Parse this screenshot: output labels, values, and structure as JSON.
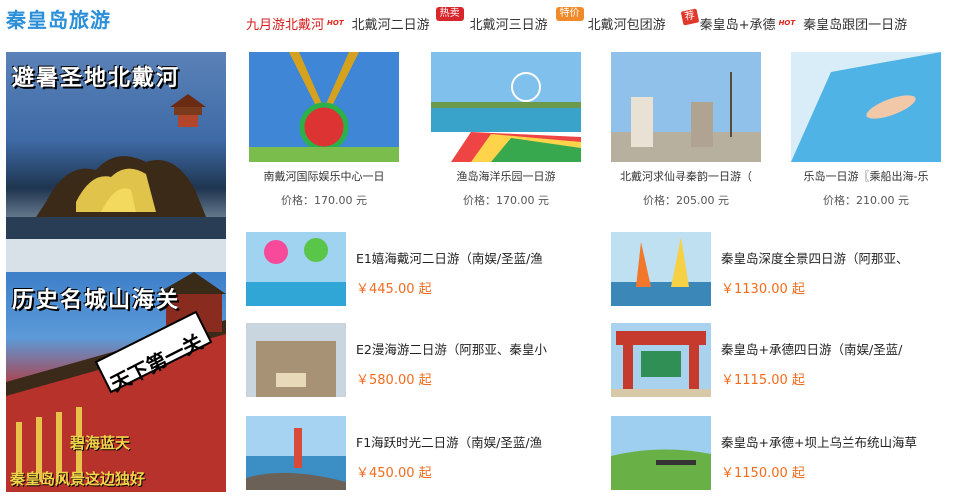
{
  "site": {
    "title": "秦皇岛旅游"
  },
  "nav": {
    "items": [
      {
        "label": "九月游北戴河",
        "active": true,
        "badge": "hot"
      },
      {
        "label": "北戴河二日游",
        "tag": "热卖"
      },
      {
        "label": "北戴河三日游",
        "tag": "特价"
      },
      {
        "label": "北戴河包团游",
        "tag": "荐"
      },
      {
        "label": "秦皇岛+承德",
        "badge": "hot"
      },
      {
        "label": "秦皇岛跟团一日游"
      }
    ],
    "hot_text": "HOT"
  },
  "banners": [
    {
      "caption": "避暑圣地北戴河"
    },
    {
      "caption": "历史名城山海关",
      "sign": "天下第一关",
      "sub1": "碧海蓝天",
      "sub2": "秦皇岛风景这边独好"
    }
  ],
  "top_products": [
    {
      "name": "南戴河国际娱乐中心一日",
      "price": "价格：170.00 元"
    },
    {
      "name": "渔岛海洋乐园一日游",
      "price": "价格：170.00 元"
    },
    {
      "name": "北戴河求仙寻秦韵一日游（",
      "price": "价格：205.00 元"
    },
    {
      "name": "乐岛一日游〖乘船出海-乐",
      "price": "价格：210.00 元"
    }
  ],
  "list_products": [
    {
      "title": "E1嬉海戴河二日游（南娱/圣蓝/渔",
      "price": "￥445.00 起"
    },
    {
      "title": "秦皇岛深度全景四日游（阿那亚、",
      "price": "￥1130.00 起"
    },
    {
      "title": "E2漫海游二日游（阿那亚、秦皇小",
      "price": "￥580.00 起"
    },
    {
      "title": "秦皇岛+承德四日游（南娱/圣蓝/",
      "price": "￥1115.00 起"
    },
    {
      "title": "F1海跃时光二日游（南娱/圣蓝/渔",
      "price": "￥450.00 起"
    },
    {
      "title": "秦皇岛+承德+坝上乌兰布统山海草",
      "price": "￥1150.00 起"
    }
  ],
  "colors": {
    "title": "#2a8fd8",
    "price": "#f26b1d",
    "active_nav": "#d61c1c"
  }
}
